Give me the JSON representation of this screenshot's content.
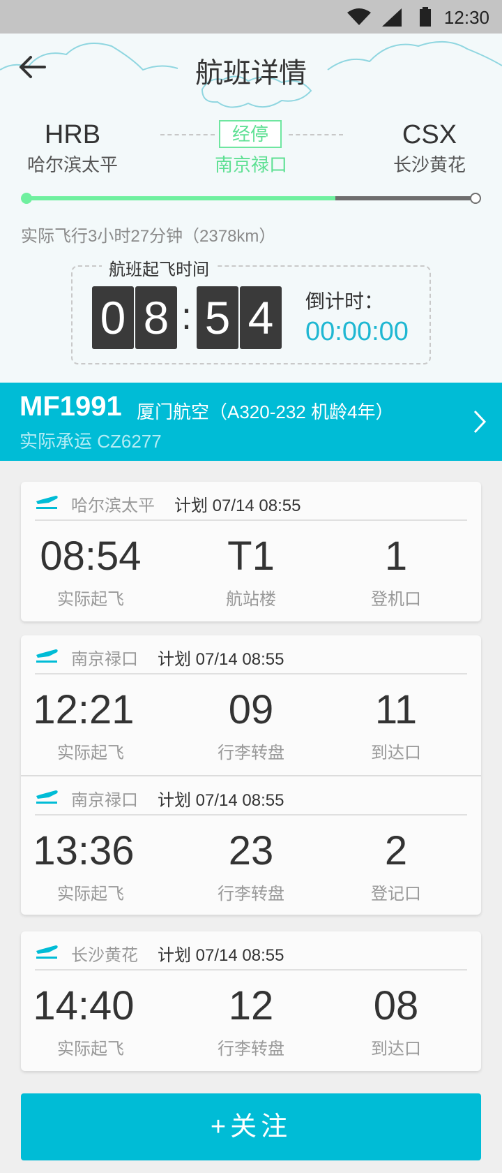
{
  "status_bar": {
    "time": "12:30",
    "icons": [
      "wifi-icon",
      "signal-icon",
      "battery-icon"
    ]
  },
  "header": {
    "title": "航班详情",
    "back_icon": "back-arrow-icon"
  },
  "route": {
    "departure": {
      "code": "HRB",
      "name": "哈尔滨太平"
    },
    "stopover": {
      "badge": "经停",
      "name": "南京禄口"
    },
    "arrival": {
      "code": "CSX",
      "name": "长沙黄花"
    },
    "progress_fraction": 0.69
  },
  "flight_duration": "实际飞行3小时27分钟（2378km）",
  "departure_time_box": {
    "label": "航班起飞时间",
    "digits": [
      "0",
      "8",
      "5",
      "4"
    ],
    "colon": ":",
    "countdown_label": "倒计时：",
    "countdown_value": "00:00:00"
  },
  "flight": {
    "number": "MF1991",
    "airline_info": "厦门航空（A320-232 机龄4年）",
    "operated_by": "实际承运 CZ6277"
  },
  "cards": [
    {
      "segments": [
        {
          "airport": "哈尔滨太平",
          "plan": "计划 07/14 08:55",
          "stats": [
            {
              "value": "08:54",
              "label": "实际起飞"
            },
            {
              "value": "T1",
              "label": "航站楼"
            },
            {
              "value": "1",
              "label": "登机口"
            }
          ]
        }
      ]
    },
    {
      "segments": [
        {
          "airport": "南京禄口",
          "plan": "计划 07/14 08:55",
          "stats": [
            {
              "value": "12:21",
              "label": "实际起飞"
            },
            {
              "value": "09",
              "label": "行李转盘"
            },
            {
              "value": "11",
              "label": "到达口"
            }
          ]
        },
        {
          "airport": "南京禄口",
          "plan": "计划 07/14 08:55",
          "stats": [
            {
              "value": "13:36",
              "label": "实际起飞"
            },
            {
              "value": "23",
              "label": "行李转盘"
            },
            {
              "value": "2",
              "label": "登记口"
            }
          ]
        }
      ]
    },
    {
      "segments": [
        {
          "airport": "长沙黄花",
          "plan": "计划 07/14 08:55",
          "stats": [
            {
              "value": "14:40",
              "label": "实际起飞"
            },
            {
              "value": "12",
              "label": "行李转盘"
            },
            {
              "value": "08",
              "label": "到达口"
            }
          ]
        }
      ]
    }
  ],
  "follow_button": "+关注",
  "colors": {
    "accent": "#00bcd6",
    "progress": "#6ff09f",
    "stopover": "#5ee093"
  }
}
